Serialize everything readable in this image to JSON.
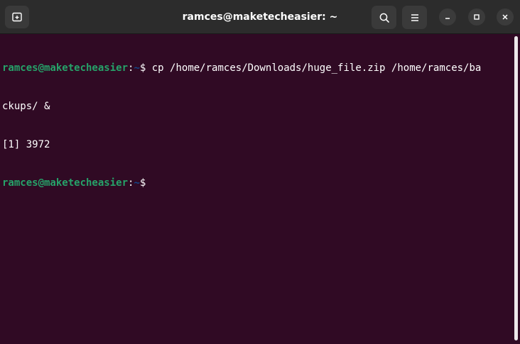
{
  "window": {
    "title": "ramces@maketecheasier: ~",
    "icons": {
      "new_tab": "new-tab-icon",
      "search": "search-icon",
      "menu": "hamburger-menu-icon",
      "minimize": "minimize-icon",
      "maximize": "maximize-icon",
      "close": "close-icon"
    }
  },
  "terminal": {
    "prompt_user": "ramces@maketecheasier",
    "prompt_colon": ":",
    "prompt_path": "~",
    "prompt_symbol": "$",
    "command_part1": " cp /home/ramces/Downloads/huge_file.zip /home/ramces/ba",
    "command_part2": "ckups/ &",
    "job_output": "[1] 3972",
    "current_input": ""
  },
  "colors": {
    "background": "#300a24",
    "titlebar": "#2c2c2c",
    "prompt_user": "#26a269",
    "prompt_path": "#12488b",
    "text": "#ffffff"
  }
}
